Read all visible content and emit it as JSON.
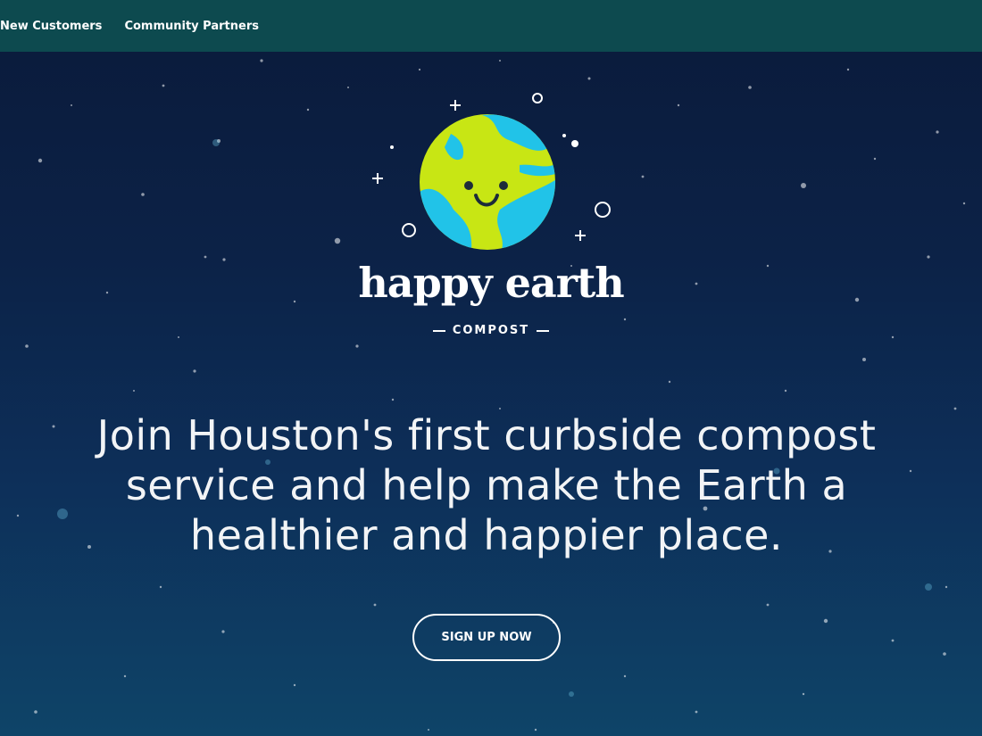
{
  "nav": {
    "items": [
      {
        "label": "New Customers"
      },
      {
        "label": "Community Partners"
      }
    ]
  },
  "brand": {
    "name": "happy earth",
    "subtitle": "COMPOST",
    "logo_icon": "smiling-earth-icon",
    "colors": {
      "land": "#c8e614",
      "ocean": "#21c3e8",
      "nav_bg": "#0d4a4f",
      "sky_top": "#0a1a3a",
      "sky_bottom": "#0e4468"
    }
  },
  "hero": {
    "headline": "Join Houston's first curbside compost service and help make the Earth a healthier and happier place.",
    "cta_label": "SIGN UP NOW"
  }
}
